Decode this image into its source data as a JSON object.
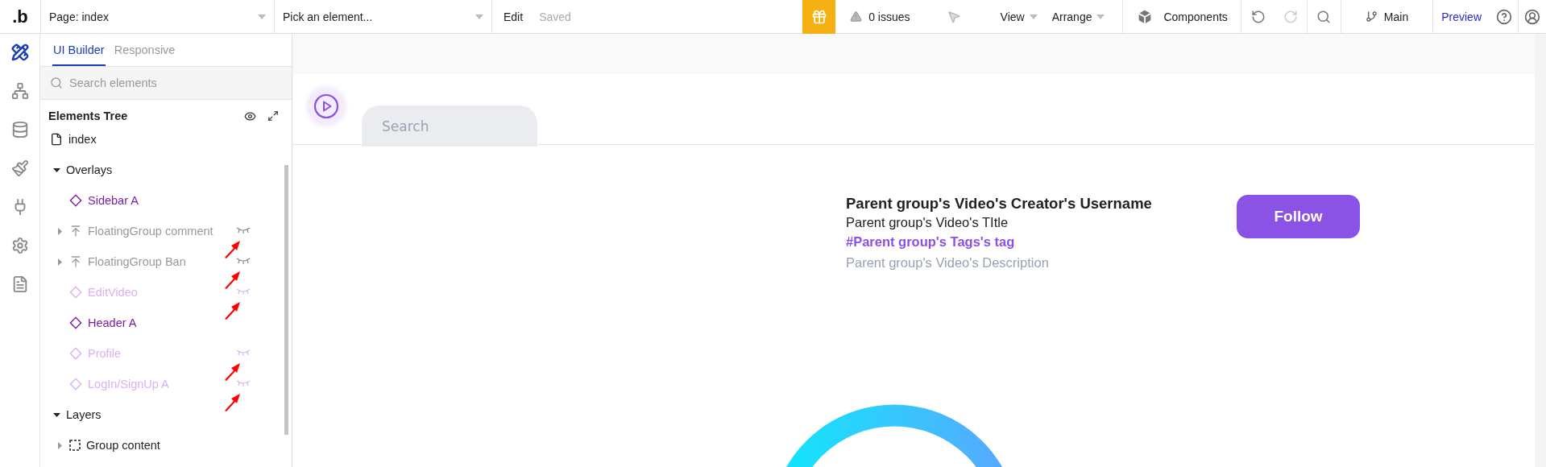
{
  "topbar": {
    "logo": ".b",
    "page_select": "Page: index",
    "element_select": "Pick an element...",
    "edit": "Edit",
    "save_status": "Saved",
    "issues": "0 issues",
    "menus": [
      {
        "label": "View"
      },
      {
        "label": "Arrange"
      }
    ],
    "components": "Components",
    "branch": "Main",
    "preview": "Preview"
  },
  "rail": [
    {
      "kind": "design",
      "selected": true
    },
    {
      "kind": "workflow",
      "selected": false
    },
    {
      "kind": "data",
      "selected": false
    },
    {
      "kind": "styles",
      "selected": false
    },
    {
      "kind": "plugins",
      "selected": false
    },
    {
      "kind": "settings",
      "selected": false
    },
    {
      "kind": "logs",
      "selected": false
    }
  ],
  "panel": {
    "tabs": [
      {
        "label": "UI Builder",
        "selected": true
      },
      {
        "label": "Responsive",
        "selected": false
      }
    ],
    "search": {
      "placeholder": "Search elements"
    },
    "tree_title": "Elements Tree",
    "tree": [
      {
        "label": "index",
        "kind": "page"
      },
      {
        "label": "Overlays",
        "kind": "section",
        "expanded": true,
        "children": [
          {
            "label": "Sidebar A",
            "kind": "element",
            "hidden": false,
            "marked": false
          },
          {
            "label": "FloatingGroup comment",
            "kind": "floating",
            "expanded": false,
            "hidden": true,
            "marked": true
          },
          {
            "label": "FloatingGroup Ban",
            "kind": "floating",
            "expanded": false,
            "hidden": true,
            "marked": true
          },
          {
            "label": "EditVideo",
            "kind": "element",
            "hidden": true,
            "marked": true
          },
          {
            "label": "Header A",
            "kind": "element",
            "hidden": false,
            "marked": false
          },
          {
            "label": "Profile",
            "kind": "element",
            "hidden": true,
            "marked": true
          },
          {
            "label": "LogIn/SignUp A",
            "kind": "element",
            "hidden": true,
            "marked": true
          }
        ]
      },
      {
        "label": "Layers",
        "kind": "section",
        "expanded": true,
        "children": [
          {
            "label": "Group content",
            "kind": "group",
            "expanded": false,
            "hidden": false,
            "marked": false
          }
        ]
      }
    ]
  },
  "canvas": {
    "search": {
      "placeholder": "Search"
    },
    "username": "Parent group's Video's Creator's Username",
    "title": "Parent group's Video's TItle",
    "tag": "#Parent group's Tags's tag",
    "description": "Parent group's Video's Description",
    "follow": "Follow"
  }
}
